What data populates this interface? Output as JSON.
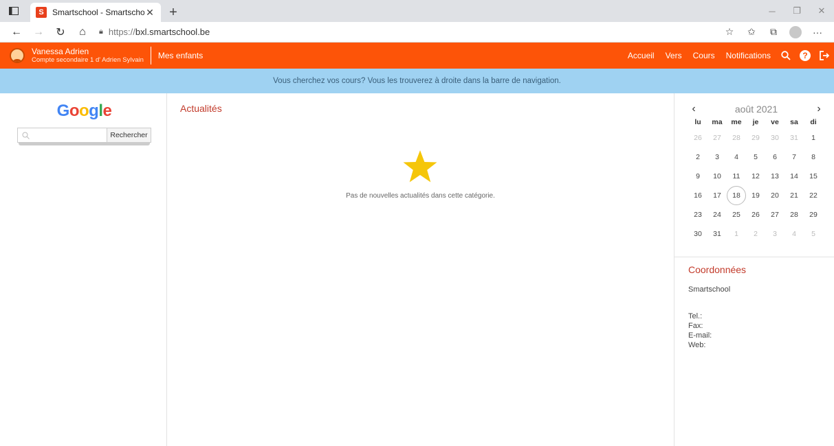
{
  "browser": {
    "tab_title": "Smartschool - Smartschool",
    "favicon_letter": "S",
    "url_protocol": "https://",
    "url_host": "bxl.smartschool.be"
  },
  "topnav": {
    "user_name": "Vanessa Adrien",
    "user_sub": "Compte secondaire 1 d' Adrien Sylvain",
    "mes_enfants": "Mes enfants",
    "links": [
      "Accueil",
      "Vers",
      "Cours",
      "Notifications"
    ],
    "accent_color": "#fd5408"
  },
  "banner": {
    "text": "Vous cherchez vos cours? Vous les trouverez à droite dans la barre de navigation."
  },
  "google": {
    "logo": [
      "G",
      "o",
      "o",
      "g",
      "l",
      "e"
    ],
    "button": "Rechercher"
  },
  "news": {
    "title": "Actualités",
    "empty": "Pas de nouvelles actualités dans cette catégorie."
  },
  "calendar": {
    "month": "août 2021",
    "prev": "‹",
    "next": "›",
    "dow": [
      "lu",
      "ma",
      "me",
      "je",
      "ve",
      "sa",
      "di"
    ],
    "days": [
      {
        "d": "26",
        "o": true
      },
      {
        "d": "27",
        "o": true
      },
      {
        "d": "28",
        "o": true
      },
      {
        "d": "29",
        "o": true
      },
      {
        "d": "30",
        "o": true
      },
      {
        "d": "31",
        "o": true
      },
      {
        "d": "1"
      },
      {
        "d": "2"
      },
      {
        "d": "3"
      },
      {
        "d": "4"
      },
      {
        "d": "5"
      },
      {
        "d": "6"
      },
      {
        "d": "7"
      },
      {
        "d": "8"
      },
      {
        "d": "9"
      },
      {
        "d": "10"
      },
      {
        "d": "11"
      },
      {
        "d": "12"
      },
      {
        "d": "13"
      },
      {
        "d": "14"
      },
      {
        "d": "15"
      },
      {
        "d": "16"
      },
      {
        "d": "17"
      },
      {
        "d": "18",
        "today": true
      },
      {
        "d": "19"
      },
      {
        "d": "20"
      },
      {
        "d": "21"
      },
      {
        "d": "22"
      },
      {
        "d": "23"
      },
      {
        "d": "24"
      },
      {
        "d": "25"
      },
      {
        "d": "26"
      },
      {
        "d": "27"
      },
      {
        "d": "28"
      },
      {
        "d": "29"
      },
      {
        "d": "30"
      },
      {
        "d": "31"
      },
      {
        "d": "1",
        "o": true
      },
      {
        "d": "2",
        "o": true
      },
      {
        "d": "3",
        "o": true
      },
      {
        "d": "4",
        "o": true
      },
      {
        "d": "5",
        "o": true
      }
    ]
  },
  "coords": {
    "title": "Coordonnées",
    "name": "Smartschool",
    "lines": [
      "Tel.:",
      "Fax:",
      "E-mail:",
      "Web:"
    ]
  }
}
